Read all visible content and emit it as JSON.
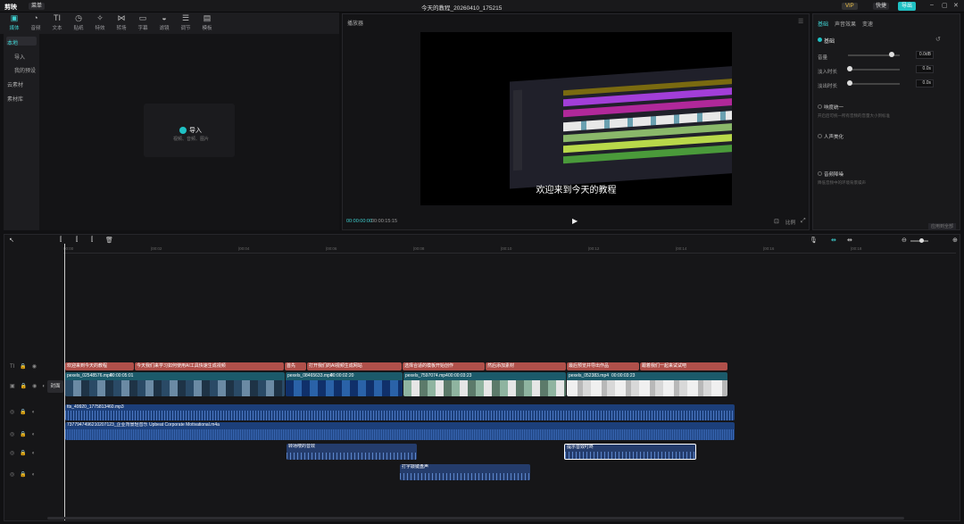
{
  "app": {
    "logo_text": "剪映",
    "menu_label": "菜单",
    "project_title": "今天的教程_20260410_175215",
    "vip_label": "VIP",
    "shortcut_label": "快捷",
    "export_label": "导出"
  },
  "toolbar": {
    "items": [
      {
        "icon": "media-icon",
        "label": "媒体"
      },
      {
        "icon": "audio-icon",
        "label": "音频"
      },
      {
        "icon": "text-icon",
        "glyph": "TI",
        "label": "文本"
      },
      {
        "icon": "sticker-icon",
        "label": "贴纸"
      },
      {
        "icon": "effects-icon",
        "label": "特效"
      },
      {
        "icon": "transition-icon",
        "label": "转场"
      },
      {
        "icon": "subtitle-icon",
        "label": "字幕"
      },
      {
        "icon": "filter-icon",
        "label": "滤镜"
      },
      {
        "icon": "adjust-icon",
        "label": "调节"
      },
      {
        "icon": "template-icon",
        "label": "模板"
      }
    ]
  },
  "leftnav": {
    "items": [
      "本地",
      "导入",
      "我的预设",
      "云素材",
      "素材库"
    ]
  },
  "media": {
    "import_label": "导入",
    "import_hint": "视频、音频、图片"
  },
  "player": {
    "title": "播放器",
    "caption": "欢迎来到今天的教程",
    "current_time": "00:00:00:00",
    "total_time": "00:00:15:15",
    "ratio_label": "比例"
  },
  "props": {
    "tabs": [
      "基础",
      "声音效果",
      "变速"
    ],
    "basic_section": "基础",
    "rows": [
      {
        "label": "音量",
        "value": "0.0dB",
        "slider": 0.8
      },
      {
        "label": "淡入时长",
        "value": "0.0s",
        "slider": 0.0
      },
      {
        "label": "淡出时长",
        "value": "0.0s",
        "slider": 0.0
      }
    ],
    "loudness_label": "响度统一",
    "loudness_desc": "开启后可统一所有音频的音量大小到标准",
    "voice_label": "人声美化",
    "denoise_label": "音频降噪",
    "denoise_desc": "降低音频中的环境背景噪声",
    "reset_label": "应用到全部"
  },
  "timeline": {
    "ruler": [
      "00:00",
      "|00:02",
      "|00:04",
      "|00:06",
      "|00:08",
      "|00:10",
      "|00:12",
      "|00:14",
      "|00:16",
      "|00:18"
    ],
    "cover_label": "封面",
    "text_clips": [
      "欢迎来到今天的教程",
      "今天我们来学习如何使用AI工具快速生成视频",
      "首先",
      "打开我们的AI视频生成网站",
      "选择合适的模板开始创作",
      "然后添加素材",
      "最后预览并导出作品",
      "跟着我们一起来试试吧"
    ],
    "video_clips": [
      {
        "name": "pexels_02548576.mp4",
        "duration": "00:00:05:01"
      },
      {
        "name": "pexels_08465633.mp4",
        "duration": "00:00:02:20"
      },
      {
        "name": "pexels_7597074.mp4",
        "duration": "00:00:03:23"
      },
      {
        "name": "pexels_052383.mp4",
        "duration": "00:00:03:23"
      }
    ],
    "audio_clips": [
      "tts_49920_1775813460.mp3",
      "7377947496210207123_企业背景轻音乐 Upbeat Corporate Motivational.m4a"
    ],
    "sfx_clips": [
      "转场嗖的音效",
      "打字敲键盘声",
      "提示音效叮咚"
    ]
  }
}
